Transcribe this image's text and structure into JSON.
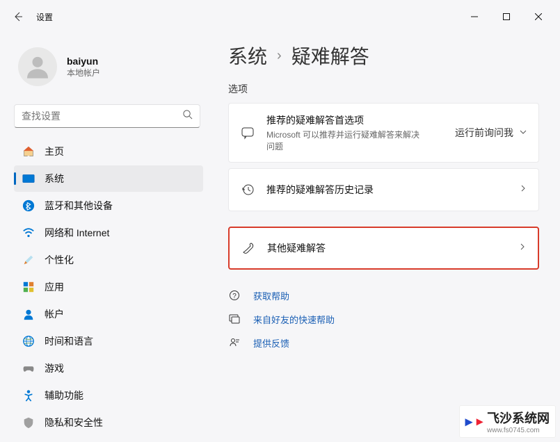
{
  "titlebar": {
    "title": "设置"
  },
  "profile": {
    "name": "baiyun",
    "subtitle": "本地帐户"
  },
  "search": {
    "placeholder": "查找设置"
  },
  "nav": {
    "items": [
      {
        "label": "主页"
      },
      {
        "label": "系统"
      },
      {
        "label": "蓝牙和其他设备"
      },
      {
        "label": "网络和 Internet"
      },
      {
        "label": "个性化"
      },
      {
        "label": "应用"
      },
      {
        "label": "帐户"
      },
      {
        "label": "时间和语言"
      },
      {
        "label": "游戏"
      },
      {
        "label": "辅助功能"
      },
      {
        "label": "隐私和安全性"
      }
    ]
  },
  "breadcrumb": {
    "parent": "系统",
    "current": "疑难解答"
  },
  "main": {
    "section_label": "选项",
    "card_recommend": {
      "title": "推荐的疑难解答首选项",
      "desc": "Microsoft 可以推荐并运行疑难解答来解决问题",
      "option": "运行前询问我"
    },
    "card_history": {
      "title": "推荐的疑难解答历史记录"
    },
    "card_other": {
      "title": "其他疑难解答"
    }
  },
  "links": {
    "help": "获取帮助",
    "quick": "来自好友的快速帮助",
    "feedback": "提供反馈"
  },
  "watermark": {
    "name": "飞沙系统网",
    "url": "www.fs0745.com"
  }
}
